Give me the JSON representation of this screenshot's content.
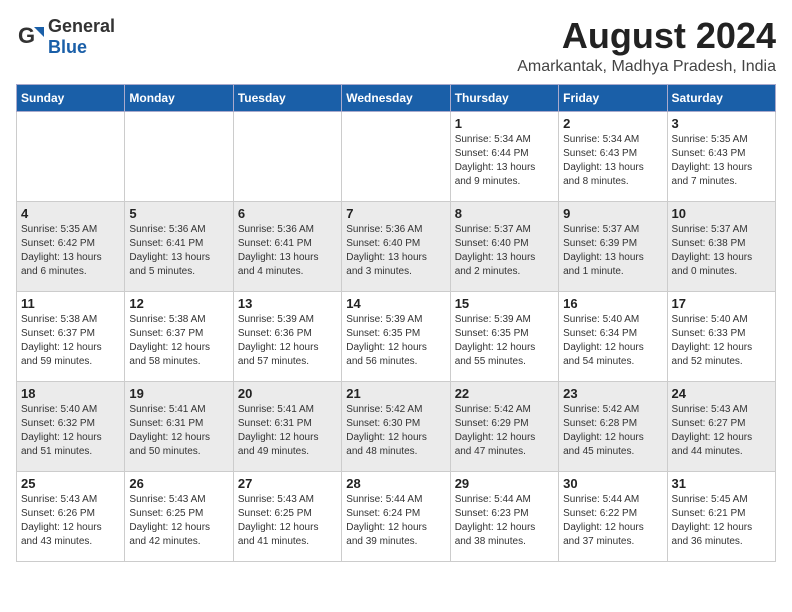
{
  "logo": {
    "general": "General",
    "blue": "Blue"
  },
  "title": "August 2024",
  "subtitle": "Amarkantak, Madhya Pradesh, India",
  "headers": [
    "Sunday",
    "Monday",
    "Tuesday",
    "Wednesday",
    "Thursday",
    "Friday",
    "Saturday"
  ],
  "weeks": [
    {
      "rowClass": "week-row-a",
      "days": [
        {
          "num": "",
          "detail": ""
        },
        {
          "num": "",
          "detail": ""
        },
        {
          "num": "",
          "detail": ""
        },
        {
          "num": "",
          "detail": ""
        },
        {
          "num": "1",
          "detail": "Sunrise: 5:34 AM\nSunset: 6:44 PM\nDaylight: 13 hours\nand 9 minutes."
        },
        {
          "num": "2",
          "detail": "Sunrise: 5:34 AM\nSunset: 6:43 PM\nDaylight: 13 hours\nand 8 minutes."
        },
        {
          "num": "3",
          "detail": "Sunrise: 5:35 AM\nSunset: 6:43 PM\nDaylight: 13 hours\nand 7 minutes."
        }
      ]
    },
    {
      "rowClass": "week-row-b",
      "days": [
        {
          "num": "4",
          "detail": "Sunrise: 5:35 AM\nSunset: 6:42 PM\nDaylight: 13 hours\nand 6 minutes."
        },
        {
          "num": "5",
          "detail": "Sunrise: 5:36 AM\nSunset: 6:41 PM\nDaylight: 13 hours\nand 5 minutes."
        },
        {
          "num": "6",
          "detail": "Sunrise: 5:36 AM\nSunset: 6:41 PM\nDaylight: 13 hours\nand 4 minutes."
        },
        {
          "num": "7",
          "detail": "Sunrise: 5:36 AM\nSunset: 6:40 PM\nDaylight: 13 hours\nand 3 minutes."
        },
        {
          "num": "8",
          "detail": "Sunrise: 5:37 AM\nSunset: 6:40 PM\nDaylight: 13 hours\nand 2 minutes."
        },
        {
          "num": "9",
          "detail": "Sunrise: 5:37 AM\nSunset: 6:39 PM\nDaylight: 13 hours\nand 1 minute."
        },
        {
          "num": "10",
          "detail": "Sunrise: 5:37 AM\nSunset: 6:38 PM\nDaylight: 13 hours\nand 0 minutes."
        }
      ]
    },
    {
      "rowClass": "week-row-a",
      "days": [
        {
          "num": "11",
          "detail": "Sunrise: 5:38 AM\nSunset: 6:37 PM\nDaylight: 12 hours\nand 59 minutes."
        },
        {
          "num": "12",
          "detail": "Sunrise: 5:38 AM\nSunset: 6:37 PM\nDaylight: 12 hours\nand 58 minutes."
        },
        {
          "num": "13",
          "detail": "Sunrise: 5:39 AM\nSunset: 6:36 PM\nDaylight: 12 hours\nand 57 minutes."
        },
        {
          "num": "14",
          "detail": "Sunrise: 5:39 AM\nSunset: 6:35 PM\nDaylight: 12 hours\nand 56 minutes."
        },
        {
          "num": "15",
          "detail": "Sunrise: 5:39 AM\nSunset: 6:35 PM\nDaylight: 12 hours\nand 55 minutes."
        },
        {
          "num": "16",
          "detail": "Sunrise: 5:40 AM\nSunset: 6:34 PM\nDaylight: 12 hours\nand 54 minutes."
        },
        {
          "num": "17",
          "detail": "Sunrise: 5:40 AM\nSunset: 6:33 PM\nDaylight: 12 hours\nand 52 minutes."
        }
      ]
    },
    {
      "rowClass": "week-row-b",
      "days": [
        {
          "num": "18",
          "detail": "Sunrise: 5:40 AM\nSunset: 6:32 PM\nDaylight: 12 hours\nand 51 minutes."
        },
        {
          "num": "19",
          "detail": "Sunrise: 5:41 AM\nSunset: 6:31 PM\nDaylight: 12 hours\nand 50 minutes."
        },
        {
          "num": "20",
          "detail": "Sunrise: 5:41 AM\nSunset: 6:31 PM\nDaylight: 12 hours\nand 49 minutes."
        },
        {
          "num": "21",
          "detail": "Sunrise: 5:42 AM\nSunset: 6:30 PM\nDaylight: 12 hours\nand 48 minutes."
        },
        {
          "num": "22",
          "detail": "Sunrise: 5:42 AM\nSunset: 6:29 PM\nDaylight: 12 hours\nand 47 minutes."
        },
        {
          "num": "23",
          "detail": "Sunrise: 5:42 AM\nSunset: 6:28 PM\nDaylight: 12 hours\nand 45 minutes."
        },
        {
          "num": "24",
          "detail": "Sunrise: 5:43 AM\nSunset: 6:27 PM\nDaylight: 12 hours\nand 44 minutes."
        }
      ]
    },
    {
      "rowClass": "week-row-a",
      "days": [
        {
          "num": "25",
          "detail": "Sunrise: 5:43 AM\nSunset: 6:26 PM\nDaylight: 12 hours\nand 43 minutes."
        },
        {
          "num": "26",
          "detail": "Sunrise: 5:43 AM\nSunset: 6:25 PM\nDaylight: 12 hours\nand 42 minutes."
        },
        {
          "num": "27",
          "detail": "Sunrise: 5:43 AM\nSunset: 6:25 PM\nDaylight: 12 hours\nand 41 minutes."
        },
        {
          "num": "28",
          "detail": "Sunrise: 5:44 AM\nSunset: 6:24 PM\nDaylight: 12 hours\nand 39 minutes."
        },
        {
          "num": "29",
          "detail": "Sunrise: 5:44 AM\nSunset: 6:23 PM\nDaylight: 12 hours\nand 38 minutes."
        },
        {
          "num": "30",
          "detail": "Sunrise: 5:44 AM\nSunset: 6:22 PM\nDaylight: 12 hours\nand 37 minutes."
        },
        {
          "num": "31",
          "detail": "Sunrise: 5:45 AM\nSunset: 6:21 PM\nDaylight: 12 hours\nand 36 minutes."
        }
      ]
    }
  ]
}
